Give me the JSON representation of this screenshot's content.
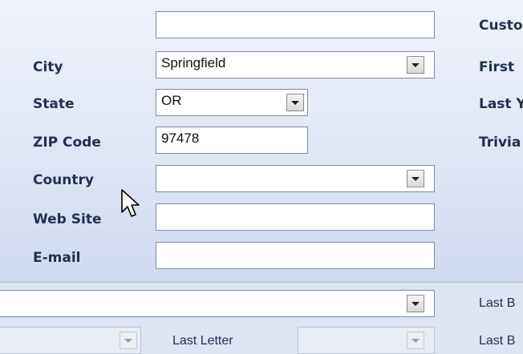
{
  "form": {
    "labels": {
      "city": "City",
      "state": "State",
      "zip": "ZIP Code",
      "country": "Country",
      "web_site": "Web Site",
      "email": "E-mail"
    },
    "values": {
      "top_field": "",
      "city": "Springfield",
      "state": "OR",
      "zip": "97478",
      "country": "",
      "web_site": "",
      "email": ""
    }
  },
  "right_labels": {
    "customer": "Custo",
    "first": "First",
    "last": "Last Y",
    "trivia": "Trivia",
    "last_b1": "Last B",
    "last_b2": "Last B"
  },
  "bottom": {
    "wide_dropdown_value": "",
    "left_dropdown_value": "",
    "last_letter_label": "Last Letter",
    "last_letter_value": ""
  },
  "icons": {
    "dropdown": "chevron-down-icon",
    "cursor": "mouse-pointer-icon"
  },
  "colors": {
    "panel_top": "#eef2fb",
    "panel_bottom": "#cfd9ee",
    "label_text": "#22314f"
  }
}
